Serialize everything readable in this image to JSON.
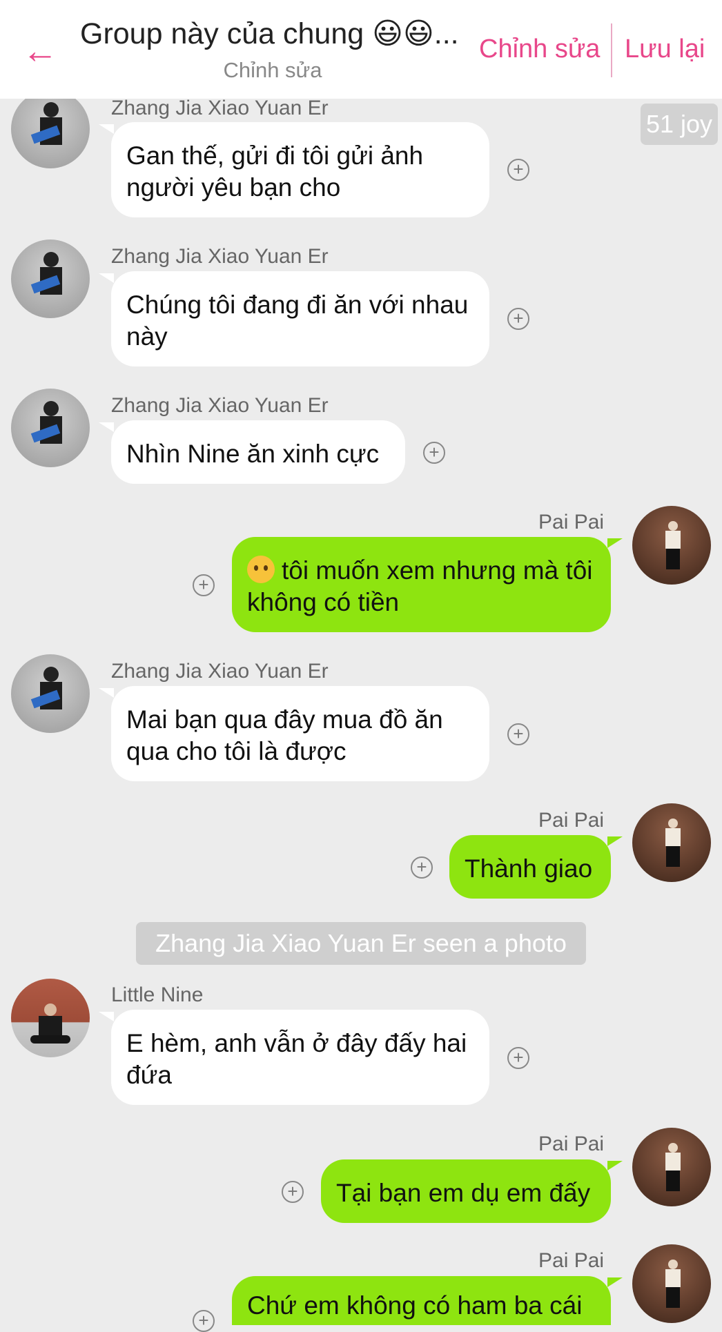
{
  "header": {
    "back_icon": "arrow-left-icon",
    "title": "Group này của chung 😃😃...",
    "subtitle": "Chỉnh sửa",
    "edit_label": "Chỉnh sửa",
    "save_label": "Lưu lại",
    "accent": "#e8478a"
  },
  "joy_badge": "51 joy",
  "system_notice": "Zhang Jia Xiao Yuan Er seen a photo",
  "colors": {
    "sent_bubble": "#8ee410",
    "received_bubble": "#ffffff",
    "background": "#ececec"
  },
  "messages": [
    {
      "sender": "Zhang Jia Xiao Yuan Er",
      "side": "left",
      "text": "Gan thế, gửi đi tôi gửi ảnh người yêu bạn cho"
    },
    {
      "sender": "Zhang Jia Xiao Yuan Er",
      "side": "left",
      "text": "Chúng tôi đang đi ăn với nhau này"
    },
    {
      "sender": "Zhang Jia Xiao Yuan Er",
      "side": "left",
      "text": "Nhìn Nine ăn xinh cực"
    },
    {
      "sender": "Pai Pai",
      "side": "right",
      "emoji": "pleading-face-emoji",
      "text": "tôi muốn xem nhưng mà tôi không có tiền"
    },
    {
      "sender": "Zhang Jia Xiao Yuan Er",
      "side": "left",
      "text": "Mai bạn qua đây mua đồ ăn qua cho tôi là được"
    },
    {
      "sender": "Pai Pai",
      "side": "right",
      "text": "Thành giao"
    },
    {
      "sender": "Little Nine",
      "side": "left",
      "text": "E hèm, anh vẫn ở đây đấy hai đứa"
    },
    {
      "sender": "Pai Pai",
      "side": "right",
      "text": "Tại bạn em dụ em đấy"
    },
    {
      "sender": "Pai Pai",
      "side": "right",
      "text": "Chứ em không có ham ba cái"
    }
  ]
}
